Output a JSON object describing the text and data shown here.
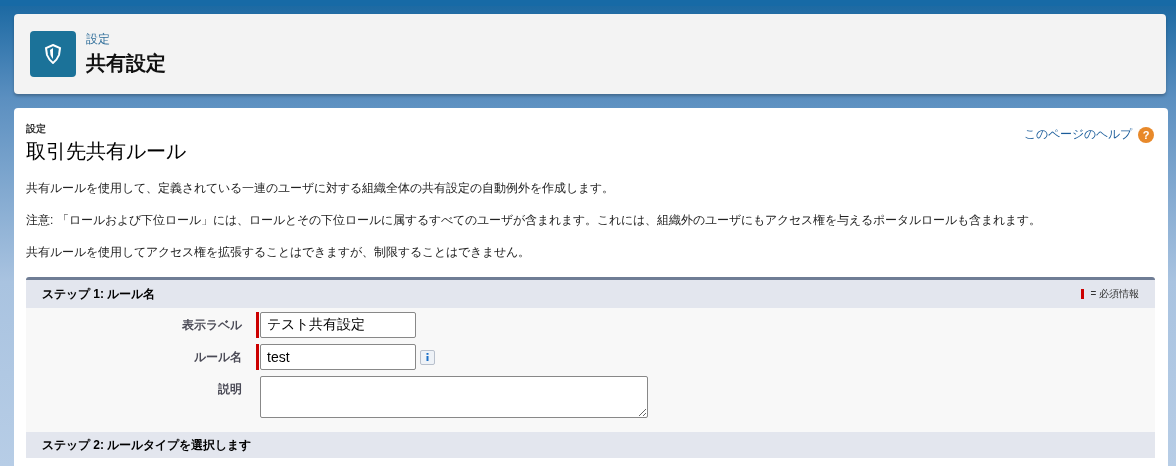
{
  "header": {
    "breadcrumb": "設定",
    "title": "共有設定"
  },
  "page": {
    "eyebrow": "設定",
    "title": "取引先共有ルール",
    "help_link": "このページのヘルプ",
    "help_icon": "?",
    "paragraphs": [
      "共有ルールを使用して、定義されている一連のユーザに対する組織全体の共有設定の自動例外を作成します。",
      "注意: 「ロールおよび下位ロール」には、ロールとその下位ロールに属するすべてのユーザが含まれます。これには、組織外のユーザにもアクセス権を与えるポータルロールも含まれます。",
      "共有ルールを使用してアクセス権を拡張することはできますが、制限することはできません。"
    ]
  },
  "step1": {
    "title": "ステップ 1: ルール名",
    "required_legend": "= 必須情報",
    "fields": [
      {
        "kind": "input",
        "label": "表示ラベル",
        "value": "テスト共有設定",
        "required": true,
        "info": false
      },
      {
        "kind": "input",
        "label": "ルール名",
        "value": "test",
        "required": true,
        "info": true
      },
      {
        "kind": "textarea",
        "label": "説明",
        "required": false,
        "info": false
      }
    ]
  },
  "step2": {
    "title": "ステップ 2: ルールタイプを選択します"
  }
}
